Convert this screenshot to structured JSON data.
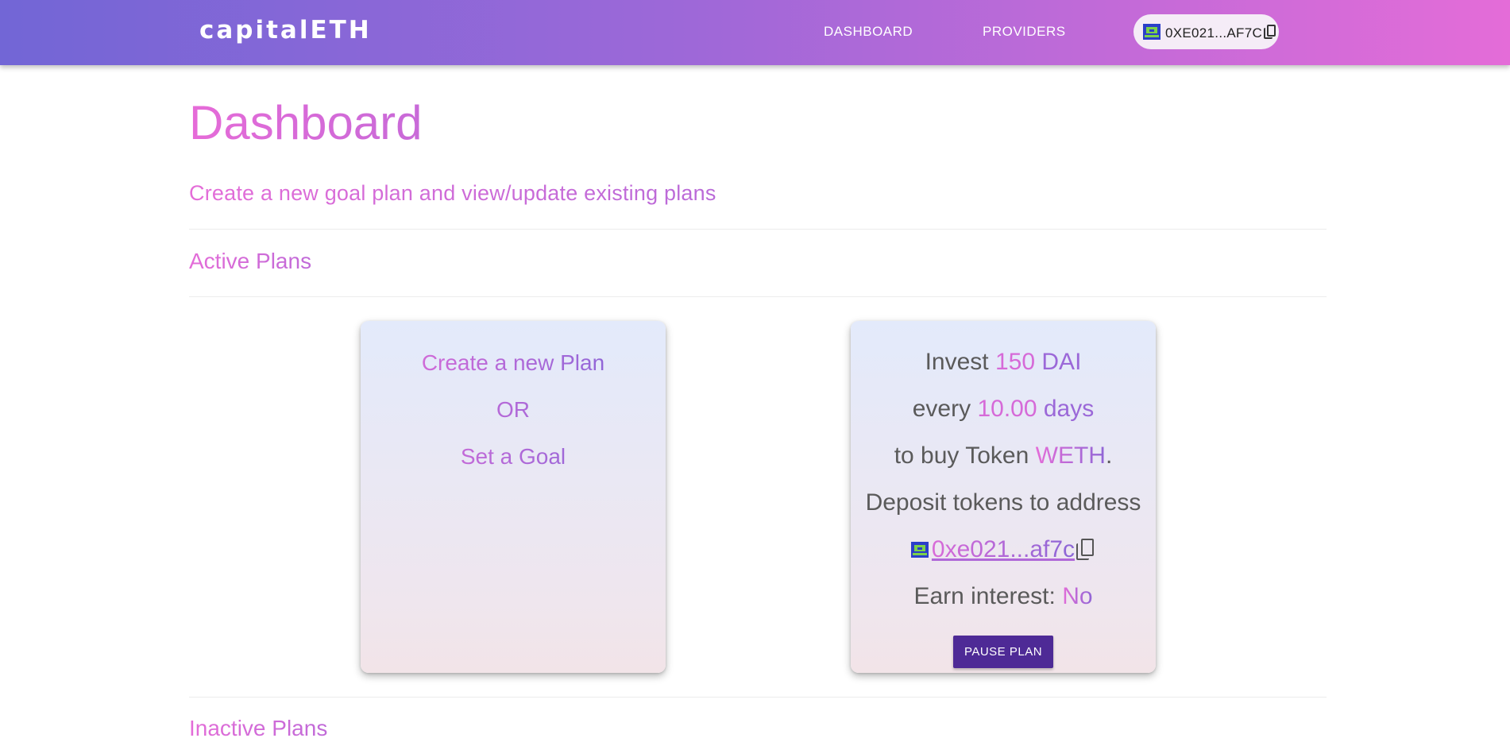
{
  "header": {
    "brand": "capitalETH",
    "nav": {
      "dashboard": "DASHBOARD",
      "providers": "PROVIDERS"
    },
    "wallet": {
      "address": "0XE021...AF7C"
    }
  },
  "page": {
    "title": "Dashboard",
    "subtitle": "Create a new goal plan and view/update existing plans"
  },
  "sections": {
    "active": "Active Plans",
    "inactive": "Inactive Plans"
  },
  "new_plan_card": {
    "create_label": "Create a new Plan",
    "or_label": "OR",
    "goal_label": "Set a Goal"
  },
  "plan_card": {
    "invest_prefix": "Invest",
    "amount": "150",
    "token_in": "DAI",
    "every_prefix": "every",
    "interval": "10.00",
    "interval_unit": "days",
    "buy_prefix": "to buy Token",
    "token_out": "WETH",
    "buy_suffix": ".",
    "deposit_label": "Deposit tokens to address",
    "deposit_address": "0xe021...af7c",
    "interest_label": "Earn interest:",
    "interest_value": "No",
    "pause_label": "PAUSE PLAN"
  },
  "colors": {
    "header_gradient_start": "#7266d6",
    "header_gradient_end": "#e46cd8",
    "button_bg": "#4e2a96",
    "accent_pink": "#e46cd8",
    "accent_purple": "#9b68d8"
  },
  "icons": {
    "wallet_identicon": "identicon-icon",
    "copy": "copy-icon"
  }
}
